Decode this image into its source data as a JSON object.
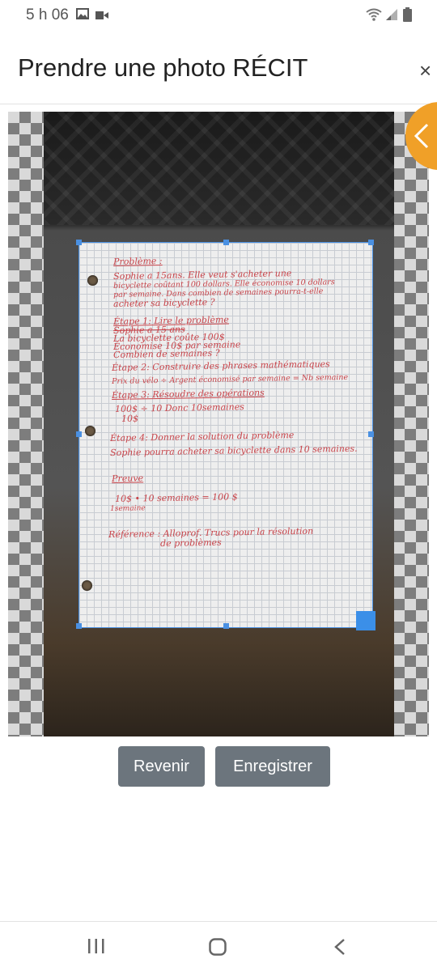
{
  "status_bar": {
    "time": "5 h 06",
    "icons": [
      "image-icon",
      "video-icon",
      "wifi-icon",
      "signal-icon",
      "battery-icon"
    ]
  },
  "header": {
    "title": "Prendre une photo RÉCIT",
    "close_symbol": "×"
  },
  "document": {
    "lines": [
      "Problème :",
      "Sophie a 15ans. Elle veut s'acheter une",
      "bicyclette coûtant 100 dollars. Elle économise 10 dollars",
      "par semaine. Dans combien de semaines pourra-t-elle",
      "acheter sa bicyclette ?",
      "Étape 1: Lire le problème",
      "Sophie a 15 ans",
      "La bicyclette coûte 100$",
      "Économise 10$ par semaine",
      "Combien de semaines ?",
      "Étape 2: Construire des phrases mathématiques",
      "Prix du vélo ÷ Argent économisé par semaine = Nb semaine",
      "Étape 3: Résoudre des opérations",
      "100$ ÷ 10 Donc 10semaines",
      "10$",
      "Étape 4: Donner la solution du problème",
      "Sophie pourra acheter sa bicyclette dans 10 semaines.",
      "Preuve",
      "10$ • 10 semaines = 100 $",
      "1semaine",
      "Référence : Alloprof. Trucs pour la résolution",
      "de problèmes"
    ]
  },
  "actions": {
    "back_label": "Revenir",
    "save_label": "Enregistrer"
  },
  "colors": {
    "accent": "#4a90e2",
    "tab": "#f0a028",
    "button": "#6c757d",
    "ink": "#c9444a"
  }
}
